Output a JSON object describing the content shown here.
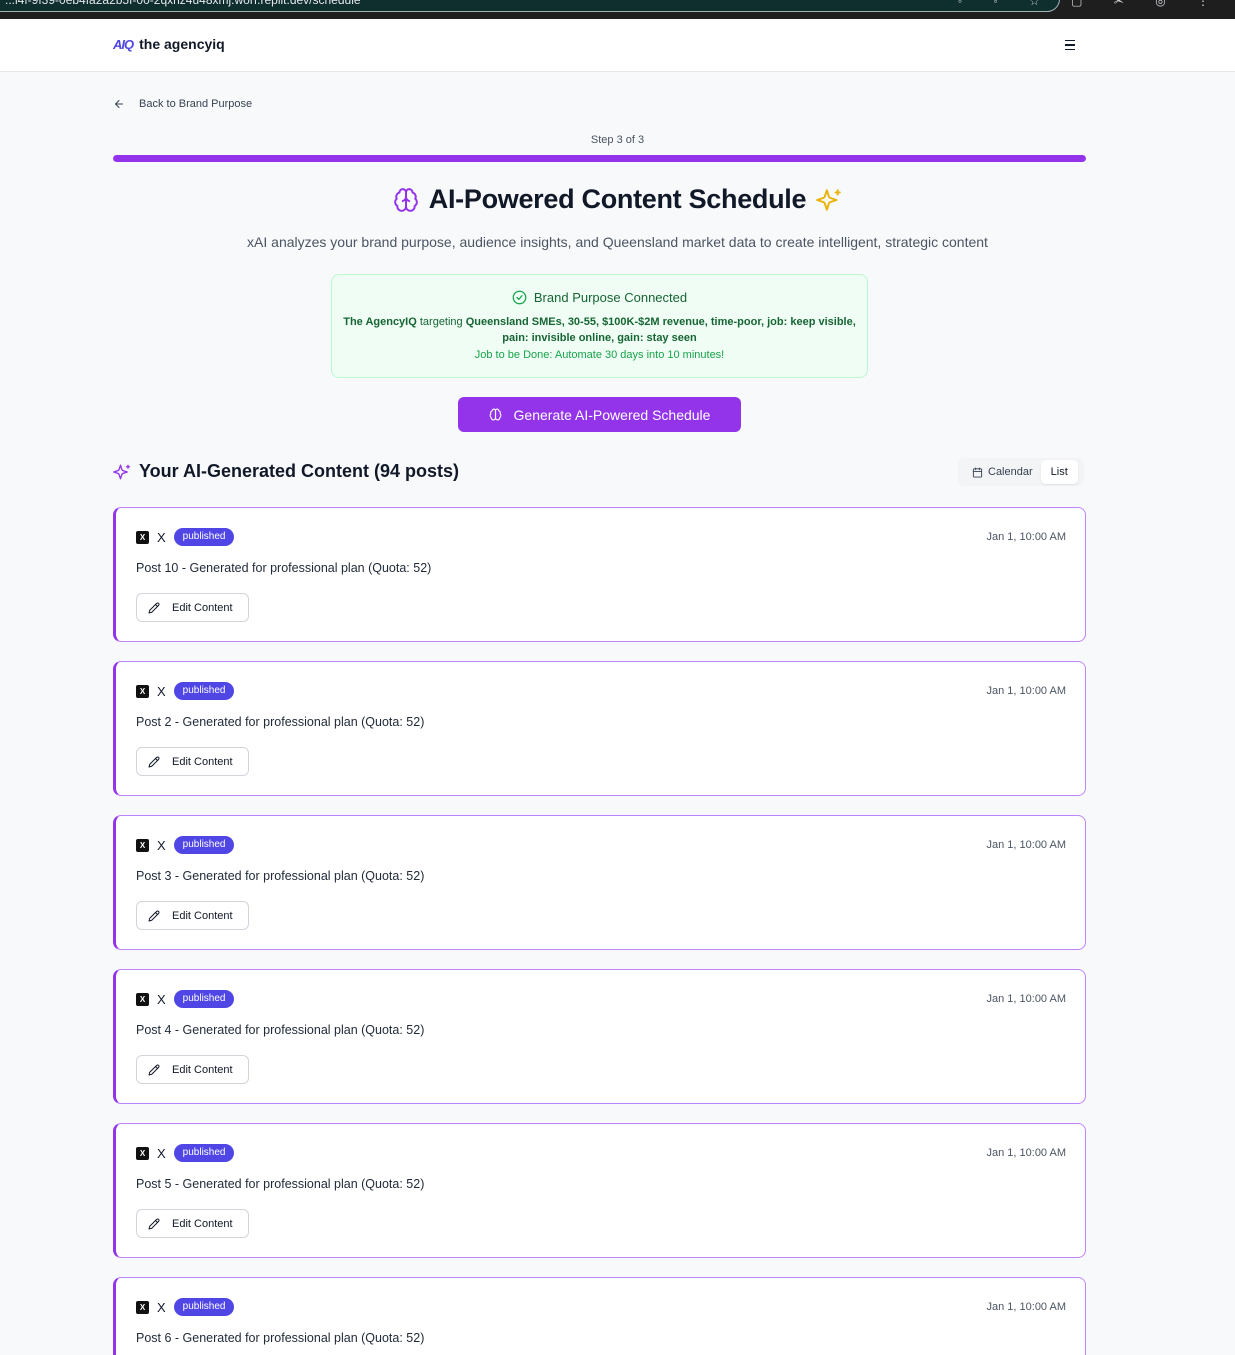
{
  "browser": {
    "url": "...l4f-9f39-0eb4fa2a2b5f-00-2qxhz4u48xmj.worf.replit.dev/schedule"
  },
  "header": {
    "logo_mark": "AIQ",
    "logo_text": "the agencyiq"
  },
  "nav": {
    "back_label": "Back to Brand Purpose"
  },
  "progress": {
    "step_label": "Step 3 of 3",
    "fraction": 1.0
  },
  "hero": {
    "title": "AI-Powered Content Schedule",
    "subtitle": "xAI analyzes your brand purpose, audience insights, and Queensland market data to create intelligent, strategic content"
  },
  "brand": {
    "status": "Brand Purpose Connected",
    "name": "The AgencyIQ",
    "targeting_word": "targeting",
    "audience": "Queensland SMEs, 30-55, $100K-$2M revenue, time-poor, job: keep visible, pain: invisible online, gain: stay seen",
    "jtbd": "Job to be Done: Automate 30 days into 10 minutes!"
  },
  "actions": {
    "generate_label": "Generate AI-Powered Schedule"
  },
  "content": {
    "heading": "Your AI-Generated Content (94 posts)",
    "view_calendar": "Calendar",
    "view_list": "List",
    "edit_label": "Edit Content"
  },
  "posts": [
    {
      "platform": "X",
      "platform_icon": "x-logo-icon",
      "status": "published",
      "date": "Jan 1, 10:00 AM",
      "text": "Post 10 - Generated for professional plan (Quota: 52)"
    },
    {
      "platform": "X",
      "platform_icon": "x-logo-icon",
      "status": "published",
      "date": "Jan 1, 10:00 AM",
      "text": "Post 2 - Generated for professional plan (Quota: 52)"
    },
    {
      "platform": "X",
      "platform_icon": "x-logo-icon",
      "status": "published",
      "date": "Jan 1, 10:00 AM",
      "text": "Post 3 - Generated for professional plan (Quota: 52)"
    },
    {
      "platform": "X",
      "platform_icon": "x-logo-icon",
      "status": "published",
      "date": "Jan 1, 10:00 AM",
      "text": "Post 4 - Generated for professional plan (Quota: 52)"
    },
    {
      "platform": "X",
      "platform_icon": "x-logo-icon",
      "status": "published",
      "date": "Jan 1, 10:00 AM",
      "text": "Post 5 - Generated for professional plan (Quota: 52)"
    },
    {
      "platform": "X",
      "platform_icon": "x-logo-icon",
      "status": "published",
      "date": "Jan 1, 10:00 AM",
      "text": "Post 6 - Generated for professional plan (Quota: 52)"
    }
  ],
  "colors": {
    "accent": "#9333ea",
    "badge": "#4f46e5",
    "success": "#166534"
  }
}
